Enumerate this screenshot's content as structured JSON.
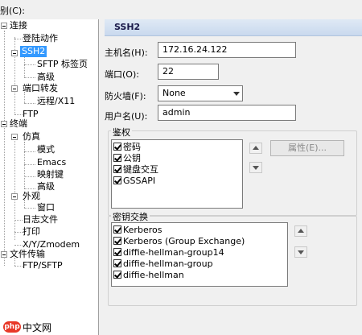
{
  "category_label": "别(C):",
  "tree": {
    "connection": "连接",
    "login_actions": "登陆动作",
    "ssh2": "SSH2",
    "sftp_tab": "SFTP 标签页",
    "advanced1": "高级",
    "port_forwarding": "端口转发",
    "remote_x11": "远程/X11",
    "ftp": "FTP",
    "terminal": "终端",
    "emulation": "仿真",
    "modes": "模式",
    "emacs": "Emacs",
    "mapped_keys": "映射键",
    "advanced2": "高级",
    "appearance": "外观",
    "window": "窗口",
    "log_file": "日志文件",
    "printing": "打印",
    "xyzmodem": "X/Y/Zmodem",
    "file_transfer": "文件传输",
    "ftp_sftp": "FTP/SFTP"
  },
  "panel_title": "SSH2",
  "form": {
    "host_label": "主机名(H):",
    "host_value": "172.16.24.122",
    "port_label": "端口(O):",
    "port_value": "22",
    "firewall_label": "防火墙(F):",
    "firewall_value": "None",
    "username_label": "用户名(U):",
    "username_value": "admin"
  },
  "auth": {
    "title": "鉴权",
    "items": [
      "密码",
      "公钥",
      "键盘交互",
      "GSSAPI"
    ],
    "properties_button": "属性(E)..."
  },
  "kex": {
    "title": "密钥交换",
    "items": [
      "Kerberos",
      "Kerberos (Group Exchange)",
      "diffie-hellman-group14",
      "diffie-hellman-group",
      "diffie-hellman"
    ]
  },
  "watermark": {
    "logo": "php",
    "text": "中文网"
  }
}
